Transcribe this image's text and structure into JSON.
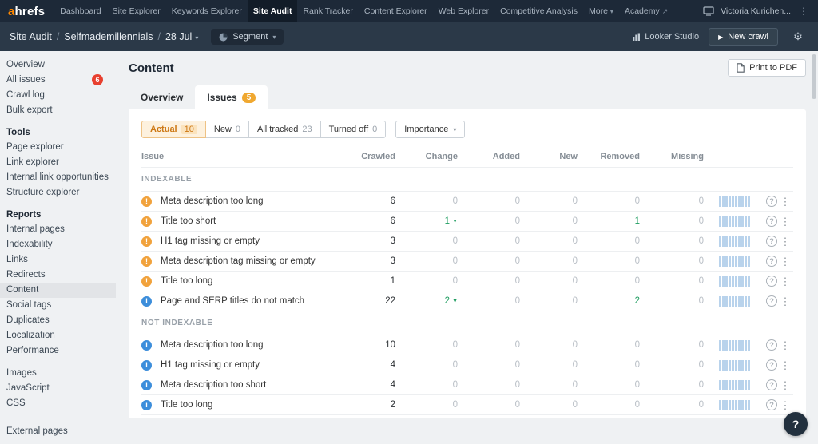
{
  "topnav": {
    "logo_a": "a",
    "logo_rest": "hrefs",
    "items": [
      {
        "label": "Dashboard"
      },
      {
        "label": "Site Explorer"
      },
      {
        "label": "Keywords Explorer"
      },
      {
        "label": "Site Audit",
        "active": true
      },
      {
        "label": "Rank Tracker"
      },
      {
        "label": "Content Explorer"
      },
      {
        "label": "Web Explorer"
      },
      {
        "label": "Competitive Analysis"
      },
      {
        "label": "More",
        "caret": true
      },
      {
        "label": "Academy",
        "external": true
      }
    ],
    "user": "Victoria Kurichen..."
  },
  "subheader": {
    "crumb_section": "Site Audit",
    "separator": "/",
    "crumb_project": "Selfmademillennials",
    "crumb_date": "28 Jul",
    "segment_label": "Segment",
    "looker_label": "Looker Studio",
    "new_crawl_label": "New crawl"
  },
  "sidebar": {
    "groups": [
      {
        "title": "",
        "items": [
          {
            "label": "Overview"
          },
          {
            "label": "All issues",
            "badge": "6"
          },
          {
            "label": "Crawl log"
          },
          {
            "label": "Bulk export"
          }
        ]
      },
      {
        "title": "Tools",
        "items": [
          {
            "label": "Page explorer"
          },
          {
            "label": "Link explorer"
          },
          {
            "label": "Internal link opportunities"
          },
          {
            "label": "Structure explorer"
          }
        ]
      },
      {
        "title": "Reports",
        "items": [
          {
            "label": "Internal pages"
          },
          {
            "label": "Indexability"
          },
          {
            "label": "Links"
          },
          {
            "label": "Redirects"
          },
          {
            "label": "Content",
            "selected": true
          },
          {
            "label": "Social tags"
          },
          {
            "label": "Duplicates"
          },
          {
            "label": "Localization"
          },
          {
            "label": "Performance"
          }
        ]
      },
      {
        "title": "",
        "items": [
          {
            "label": "Images"
          },
          {
            "label": "JavaScript"
          },
          {
            "label": "CSS"
          }
        ]
      },
      {
        "title": "",
        "last": true,
        "items": [
          {
            "label": "External pages"
          }
        ]
      }
    ]
  },
  "main": {
    "title": "Content",
    "print_label": "Print to PDF",
    "tabs": [
      {
        "label": "Overview",
        "active": false
      },
      {
        "label": "Issues",
        "badge": "5",
        "active": true
      }
    ],
    "filters": [
      {
        "label": "Actual",
        "count": "10",
        "active": true
      },
      {
        "label": "New",
        "count": "0"
      },
      {
        "label": "All tracked",
        "count": "23"
      },
      {
        "label": "Turned off",
        "count": "0"
      }
    ],
    "importance_label": "Importance",
    "table": {
      "headers": [
        "Issue",
        "Crawled",
        "Change",
        "Added",
        "New",
        "Removed",
        "Missing"
      ],
      "sections": [
        {
          "name": "INDEXABLE",
          "rows": [
            {
              "severity": "warning",
              "issue": "Meta description too long",
              "crawled": "6",
              "change": "0",
              "change_trend": "",
              "added": "0",
              "new": "0",
              "removed": "0",
              "removed_highlight": false,
              "missing": "0"
            },
            {
              "severity": "warning",
              "issue": "Title too short",
              "crawled": "6",
              "change": "1",
              "change_trend": "down",
              "added": "0",
              "new": "0",
              "removed": "1",
              "removed_highlight": true,
              "missing": "0"
            },
            {
              "severity": "warning",
              "issue": "H1 tag missing or empty",
              "crawled": "3",
              "change": "0",
              "change_trend": "",
              "added": "0",
              "new": "0",
              "removed": "0",
              "removed_highlight": false,
              "missing": "0"
            },
            {
              "severity": "warning",
              "issue": "Meta description tag missing or empty",
              "crawled": "3",
              "change": "0",
              "change_trend": "",
              "added": "0",
              "new": "0",
              "removed": "0",
              "removed_highlight": false,
              "missing": "0"
            },
            {
              "severity": "warning",
              "issue": "Title too long",
              "crawled": "1",
              "change": "0",
              "change_trend": "",
              "added": "0",
              "new": "0",
              "removed": "0",
              "removed_highlight": false,
              "missing": "0"
            },
            {
              "severity": "info",
              "issue": "Page and SERP titles do not match",
              "crawled": "22",
              "change": "2",
              "change_trend": "down",
              "added": "0",
              "new": "0",
              "removed": "2",
              "removed_highlight": true,
              "missing": "0"
            }
          ]
        },
        {
          "name": "NOT INDEXABLE",
          "rows": [
            {
              "severity": "info",
              "issue": "Meta description too long",
              "crawled": "10",
              "change": "0",
              "change_trend": "",
              "added": "0",
              "new": "0",
              "removed": "0",
              "removed_highlight": false,
              "missing": "0"
            },
            {
              "severity": "info",
              "issue": "H1 tag missing or empty",
              "crawled": "4",
              "change": "0",
              "change_trend": "",
              "added": "0",
              "new": "0",
              "removed": "0",
              "removed_highlight": false,
              "missing": "0"
            },
            {
              "severity": "info",
              "issue": "Meta description too short",
              "crawled": "4",
              "change": "0",
              "change_trend": "",
              "added": "0",
              "new": "0",
              "removed": "0",
              "removed_highlight": false,
              "missing": "0"
            },
            {
              "severity": "info",
              "issue": "Title too long",
              "crawled": "2",
              "change": "0",
              "change_trend": "",
              "added": "0",
              "new": "0",
              "removed": "0",
              "removed_highlight": false,
              "missing": "0"
            }
          ]
        }
      ]
    }
  },
  "help_fab": "?",
  "colors": {
    "accent_orange": "#ff8800",
    "nav_bg": "#1d2938",
    "subnav_bg": "#2b3948",
    "warning_icon": "#f1a23c",
    "info_icon": "#3d8edb",
    "positive_green": "#1f9d61",
    "badge_red": "#e8402f",
    "tab_badge_yellow": "#f0a830",
    "sparkline_blue": "#b9d3ec",
    "active_filter_text": "#cd7814"
  }
}
